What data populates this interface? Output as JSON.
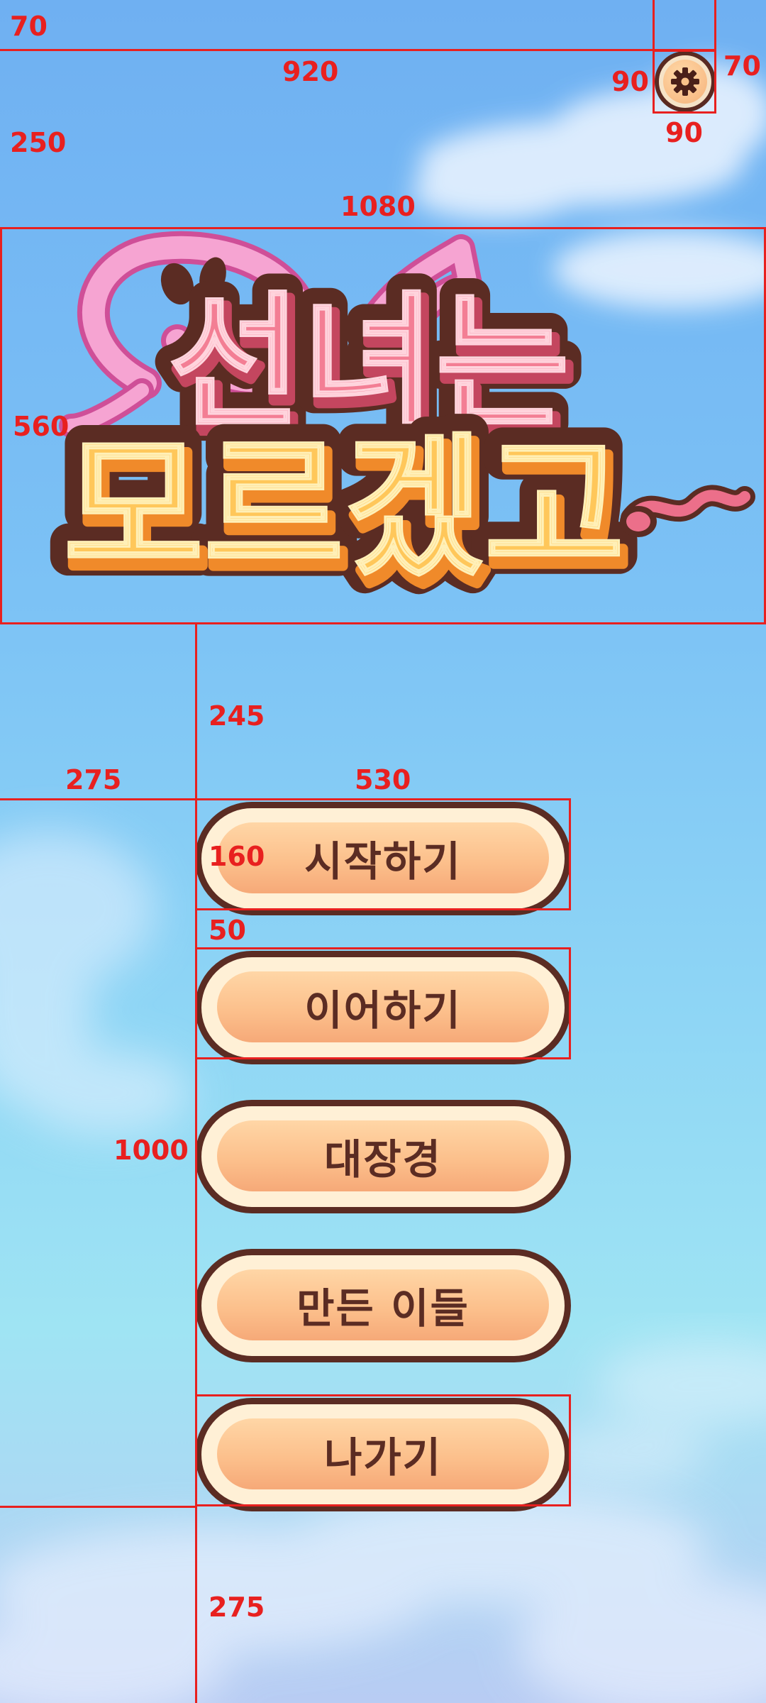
{
  "menu": {
    "start_label": "시작하기",
    "continue_label": "이어하기",
    "journey_label": "대장경",
    "credits_label": "만든 이들",
    "exit_label": "나가기"
  },
  "settings": {
    "icon": "gear-icon"
  },
  "logo": {
    "title_line1": "선녀는",
    "title_line2": "모르겠고",
    "decoration": "ribbon"
  },
  "guides": {
    "top_margin": "70",
    "settings_left": "920",
    "settings_width": "90",
    "settings_right": "70",
    "settings_height": "90",
    "logo_top": "250",
    "logo_width": "1080",
    "logo_height": "560",
    "menu_gap_top": "245",
    "menu_left": "275",
    "menu_width": "530",
    "button_height": "160",
    "button_gap": "50",
    "menu_height": "1000",
    "bottom_margin": "275"
  },
  "colors": {
    "button_border": "#5b2c23",
    "button_face": "#fcc08c",
    "logo_pink": "#f37e94",
    "logo_orange": "#ffb347",
    "guide_red": "#e8201f"
  }
}
